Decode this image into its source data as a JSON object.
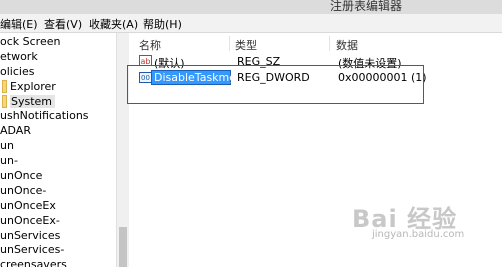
{
  "window": {
    "title": "注册表编辑器"
  },
  "menu": [
    {
      "label": "编辑(E)"
    },
    {
      "label": "查看(V)"
    },
    {
      "label": "收藏夹(A)"
    },
    {
      "label": "帮助(H)"
    }
  ],
  "tree": {
    "items": [
      {
        "label": "ock Screen"
      },
      {
        "label": "etwork"
      },
      {
        "label": "olicies"
      },
      {
        "label": "Explorer"
      },
      {
        "label": "System",
        "selected": true
      },
      {
        "label": "ushNotifications"
      },
      {
        "label": "ADAR"
      },
      {
        "label": "un"
      },
      {
        "label": "un-"
      },
      {
        "label": "unOnce"
      },
      {
        "label": "unOnce-"
      },
      {
        "label": "unOnceEx"
      },
      {
        "label": "unOnceEx-"
      },
      {
        "label": "unServices"
      },
      {
        "label": "unServices-"
      },
      {
        "label": "creensavers"
      }
    ]
  },
  "list": {
    "headers": {
      "name": "名称",
      "type": "类型",
      "data": "数据"
    },
    "rows": [
      {
        "icon": "string-value-icon",
        "icon_text": "ab",
        "name": "(默认)",
        "type": "REG_SZ",
        "data": "(数值未设置)"
      },
      {
        "icon": "binary-value-icon",
        "icon_text": "00",
        "name": "DisableTaskmgr",
        "type": "REG_DWORD",
        "data": "0x00000001 (1)",
        "editing": true
      }
    ]
  },
  "watermark": {
    "logo": "Bai 经验",
    "url": "jingyan.baidu.com"
  },
  "colors": {
    "highlight": "#e02020",
    "selection": "#3399ff"
  }
}
